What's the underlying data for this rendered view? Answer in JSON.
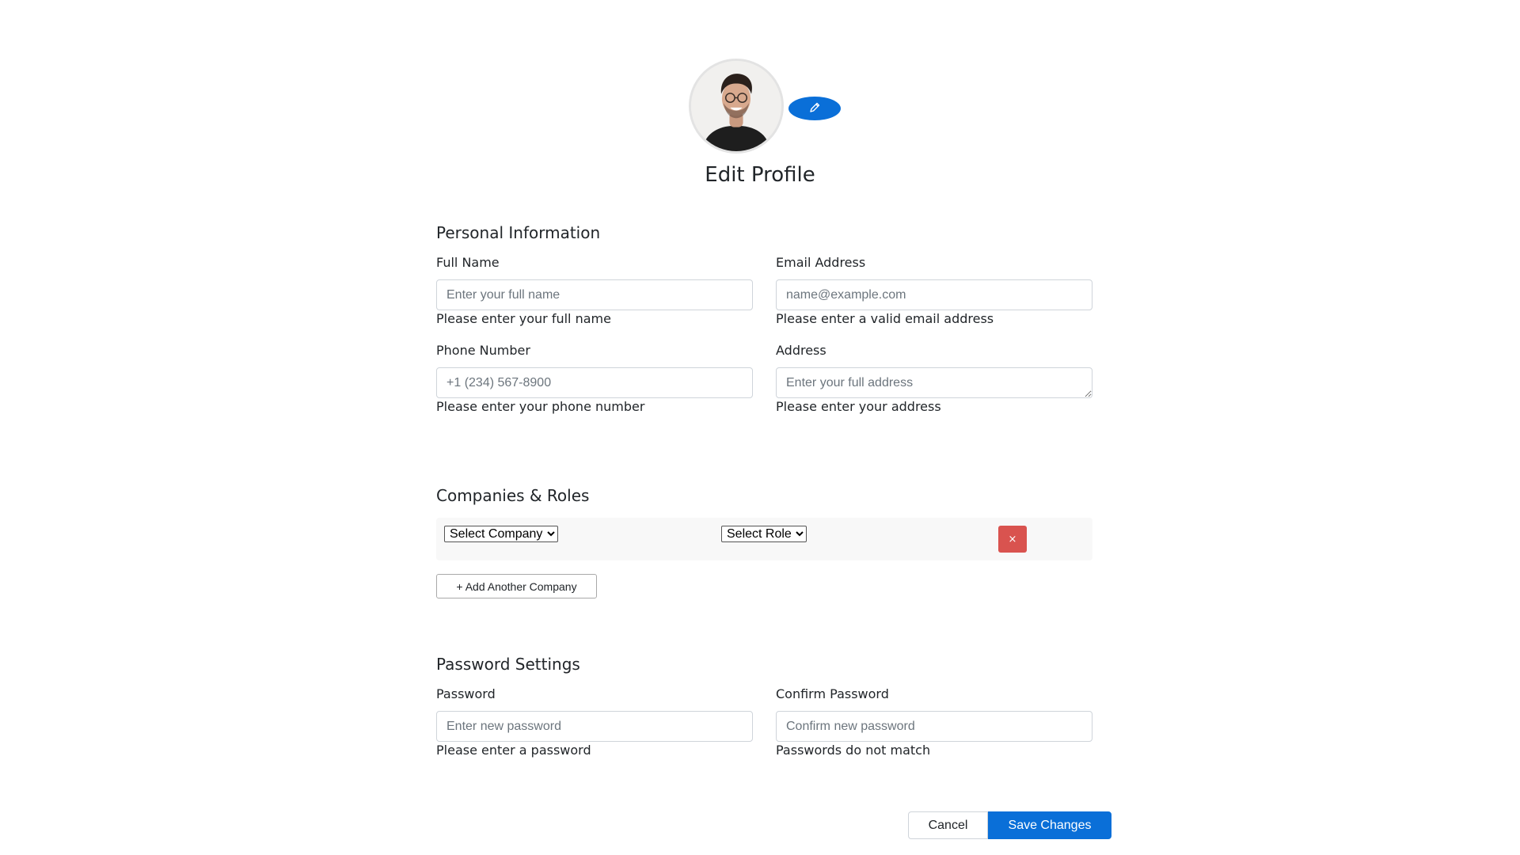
{
  "header": {
    "title": "Edit Profile",
    "avatar_alt": "Profile photo",
    "edit_avatar_icon": "pencil-icon"
  },
  "personal": {
    "section_title": "Personal Information",
    "full_name": {
      "label": "Full Name",
      "value": "",
      "placeholder": "Enter your full name",
      "help": "Please enter your full name"
    },
    "email": {
      "label": "Email Address",
      "value": "",
      "placeholder": "name@example.com",
      "help": "Please enter a valid email address"
    },
    "phone": {
      "label": "Phone Number",
      "value": "",
      "placeholder": "+1 (234) 567-8900",
      "help": "Please enter your phone number"
    },
    "address": {
      "label": "Address",
      "value": "",
      "placeholder": "Enter your full address",
      "help": "Please enter your address"
    }
  },
  "companies": {
    "section_title": "Companies & Roles",
    "rows": [
      {
        "company_selected": "Select Company",
        "role_selected": "Select Role",
        "remove_label": "×"
      }
    ],
    "add_label": "+ Add Another Company",
    "danger_color": "#d9534f"
  },
  "password": {
    "section_title": "Password Settings",
    "new": {
      "label": "Password",
      "value": "",
      "placeholder": "Enter new password",
      "help": "Please enter a password"
    },
    "confirm": {
      "label": "Confirm Password",
      "value": "",
      "placeholder": "Confirm new password",
      "help": "Passwords do not match"
    }
  },
  "actions": {
    "cancel_label": "Cancel",
    "save_label": "Save Changes",
    "primary_color": "#0a6fd8"
  }
}
